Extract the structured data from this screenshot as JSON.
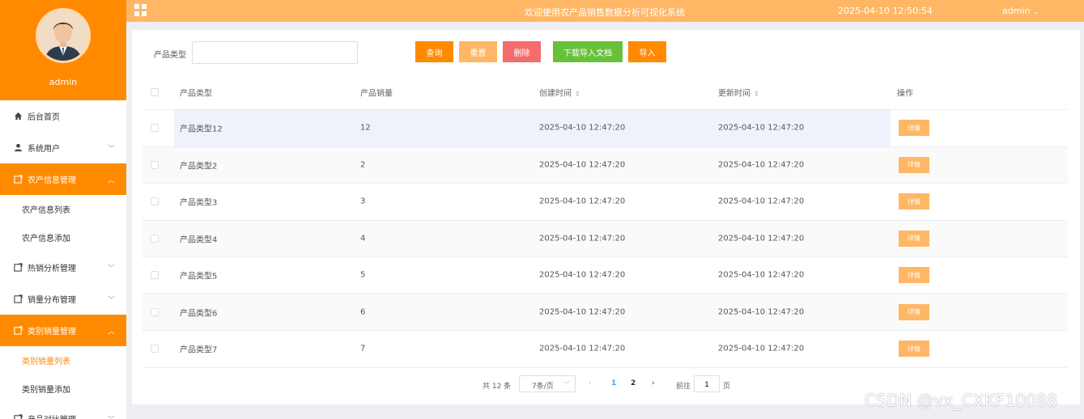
{
  "sidebar": {
    "username": "admin",
    "menu": [
      {
        "label": "后台首页",
        "icon": "home-icon"
      },
      {
        "label": "系统用户",
        "icon": "user-icon"
      },
      {
        "label": "农产信息管理",
        "icon": "folder-icon"
      },
      {
        "label": "农产信息列表"
      },
      {
        "label": "农产信息添加"
      },
      {
        "label": "热销分析管理",
        "icon": "folder-icon"
      },
      {
        "label": "销量分布管理",
        "icon": "folder-icon"
      },
      {
        "label": "类别销量管理",
        "icon": "folder-icon"
      },
      {
        "label": "类别销量列表"
      },
      {
        "label": "类别销量添加"
      },
      {
        "label": "产品对比管理",
        "icon": "folder-icon"
      }
    ]
  },
  "header": {
    "title": "欢迎使用农产品销售数据分析可视化系统",
    "datetime": "2025-04-10 12:50:54",
    "user": "admin"
  },
  "search": {
    "label": "产品类型",
    "value": "",
    "placeholder": ""
  },
  "toolbar": {
    "query": "查询",
    "reset": "重置",
    "delete": "删除",
    "download": "下载导入文档",
    "import": "导入"
  },
  "table": {
    "headers": {
      "type": "产品类型",
      "sales": "产品销量",
      "created": "创建时间",
      "updated": "更新时间",
      "op": "操作"
    },
    "detail_label": "详情",
    "rows": [
      {
        "type": "产品类型12",
        "sales": "12",
        "created": "2025-04-10 12:47:20",
        "updated": "2025-04-10 12:47:20"
      },
      {
        "type": "产品类型2",
        "sales": "2",
        "created": "2025-04-10 12:47:20",
        "updated": "2025-04-10 12:47:20"
      },
      {
        "type": "产品类型3",
        "sales": "3",
        "created": "2025-04-10 12:47:20",
        "updated": "2025-04-10 12:47:20"
      },
      {
        "type": "产品类型4",
        "sales": "4",
        "created": "2025-04-10 12:47:20",
        "updated": "2025-04-10 12:47:20"
      },
      {
        "type": "产品类型5",
        "sales": "5",
        "created": "2025-04-10 12:47:20",
        "updated": "2025-04-10 12:47:20"
      },
      {
        "type": "产品类型6",
        "sales": "6",
        "created": "2025-04-10 12:47:20",
        "updated": "2025-04-10 12:47:20"
      },
      {
        "type": "产品类型7",
        "sales": "7",
        "created": "2025-04-10 12:47:20",
        "updated": "2025-04-10 12:47:20"
      }
    ]
  },
  "pagination": {
    "total": "共 12 条",
    "page_size": "7条/页",
    "pages": [
      "1",
      "2"
    ],
    "current": "1",
    "goto_label": "前往",
    "goto_value": "1",
    "page_label": "页"
  },
  "watermark": "CSDN @vx_CXKF10088",
  "colors": {
    "brand_orange": "#ff8a00",
    "header_orange": "#ffb766",
    "delete_red": "#f56c6c",
    "download_green": "#67c23a",
    "active_page_blue": "#409eff"
  }
}
